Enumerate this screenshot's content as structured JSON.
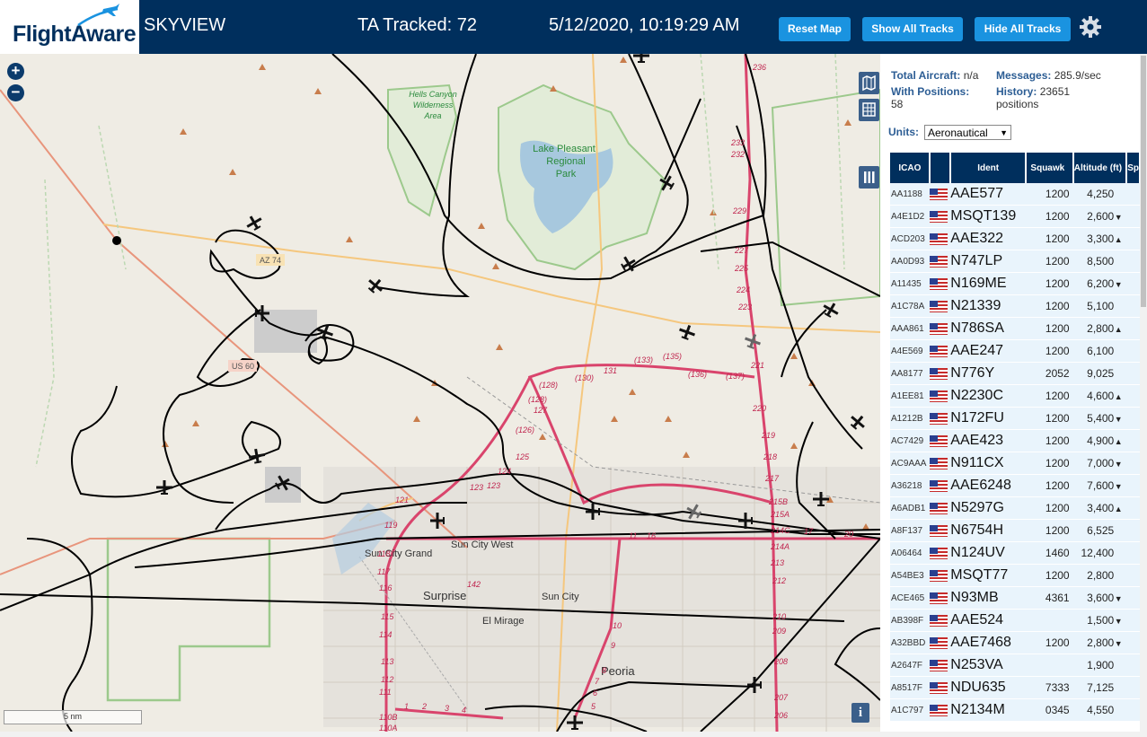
{
  "header": {
    "logo_text": "FlightAware",
    "app_name": "SKYVIEW",
    "tracked": "TA Tracked: 72",
    "datetime": "5/12/2020, 10:19:29 AM",
    "buttons": {
      "reset": "Reset Map",
      "show_all": "Show All Tracks",
      "hide_all": "Hide All Tracks"
    },
    "settings_icon": "gear-icon"
  },
  "map": {
    "zoom_in": "+",
    "zoom_out": "−",
    "scale": "5 nm",
    "info": "i",
    "tool_icons": [
      "map-layers-icon",
      "grid-icon",
      "columns-icon"
    ],
    "labels": {
      "wilderness": [
        "Hells Canyon",
        "Wilderness",
        "Area"
      ],
      "lake": [
        "Lake Pleasant",
        "Regional",
        "Park"
      ],
      "az74": "AZ 74",
      "us60": "US 60",
      "sun_city_west": "Sun City West",
      "sun_city_grand": "Sun City Grand",
      "surprise": "Surprise",
      "sun_city": "Sun City",
      "el_mirage": "El Mirage",
      "peoria": "Peoria"
    },
    "exits": [
      "236",
      "233",
      "232",
      "229",
      "227",
      "225",
      "224",
      "223",
      "221",
      "220",
      "219",
      "218",
      "217",
      "215B",
      "215A",
      "214C",
      "214A",
      "213",
      "212",
      "210",
      "209",
      "208",
      "207",
      "206",
      "(128)",
      "(130)",
      "131",
      "(133)",
      "(135)",
      "(136)",
      "(137)",
      "(128)",
      "127",
      "(126)",
      "125",
      "124",
      "123",
      "123",
      "121",
      "119",
      "118",
      "117",
      "116",
      "115",
      "114",
      "113",
      "112",
      "111",
      "110B",
      "110A",
      "142",
      "1",
      "2",
      "3",
      "4",
      "5",
      "6",
      "7",
      "8",
      "9",
      "10",
      "11",
      "16",
      "17",
      "20",
      "24",
      "26"
    ]
  },
  "sidebar": {
    "total_aircraft_label": "Total Aircraft:",
    "total_aircraft": "n/a",
    "messages_label": "Messages:",
    "messages": "285.9/sec",
    "with_positions_label": "With Positions:",
    "with_positions": "58",
    "history_label": "History:",
    "history": "23651",
    "history_unit": "positions",
    "units_label": "Units:",
    "units_value": "Aeronautical",
    "columns": [
      "ICAO",
      "",
      "Ident",
      "Squawk",
      "Altitude (ft)",
      "Sp"
    ],
    "rows": [
      {
        "icao": "AA1188",
        "ident": "AAE577",
        "squawk": "1200",
        "alt": "4,250",
        "trend": ""
      },
      {
        "icao": "A4E1D2",
        "ident": "MSQT139",
        "squawk": "1200",
        "alt": "2,600",
        "trend": "▼"
      },
      {
        "icao": "ACD203",
        "ident": "AAE322",
        "squawk": "1200",
        "alt": "3,300",
        "trend": "▲"
      },
      {
        "icao": "AA0D93",
        "ident": "N747LP",
        "squawk": "1200",
        "alt": "8,500",
        "trend": ""
      },
      {
        "icao": "A11435",
        "ident": "N169ME",
        "squawk": "1200",
        "alt": "6,200",
        "trend": "▼"
      },
      {
        "icao": "A1C78A",
        "ident": "N21339",
        "squawk": "1200",
        "alt": "5,100",
        "trend": ""
      },
      {
        "icao": "AAA861",
        "ident": "N786SA",
        "squawk": "1200",
        "alt": "2,800",
        "trend": "▲"
      },
      {
        "icao": "A4E569",
        "ident": "AAE247",
        "squawk": "1200",
        "alt": "6,100",
        "trend": ""
      },
      {
        "icao": "AA8177",
        "ident": "N776Y",
        "squawk": "2052",
        "alt": "9,025",
        "trend": ""
      },
      {
        "icao": "A1EE81",
        "ident": "N2230C",
        "squawk": "1200",
        "alt": "4,600",
        "trend": "▲"
      },
      {
        "icao": "A1212B",
        "ident": "N172FU",
        "squawk": "1200",
        "alt": "5,400",
        "trend": "▼"
      },
      {
        "icao": "AC7429",
        "ident": "AAE423",
        "squawk": "1200",
        "alt": "4,900",
        "trend": "▲"
      },
      {
        "icao": "AC9AAA",
        "ident": "N911CX",
        "squawk": "1200",
        "alt": "7,000",
        "trend": "▼"
      },
      {
        "icao": "A36218",
        "ident": "AAE6248",
        "squawk": "1200",
        "alt": "7,600",
        "trend": "▼"
      },
      {
        "icao": "A6ADB1",
        "ident": "N5297G",
        "squawk": "1200",
        "alt": "3,400",
        "trend": "▲"
      },
      {
        "icao": "A8F137",
        "ident": "N6754H",
        "squawk": "1200",
        "alt": "6,525",
        "trend": ""
      },
      {
        "icao": "A06464",
        "ident": "N124UV",
        "squawk": "1460",
        "alt": "12,400",
        "trend": ""
      },
      {
        "icao": "A54BE3",
        "ident": "MSQT77",
        "squawk": "1200",
        "alt": "2,800",
        "trend": ""
      },
      {
        "icao": "ACE465",
        "ident": "N93MB",
        "squawk": "4361",
        "alt": "3,600",
        "trend": "▼"
      },
      {
        "icao": "AB398F",
        "ident": "AAE524",
        "squawk": "",
        "alt": "1,500",
        "trend": "▼"
      },
      {
        "icao": "A32BBD",
        "ident": "AAE7468",
        "squawk": "1200",
        "alt": "2,800",
        "trend": "▼"
      },
      {
        "icao": "A2647F",
        "ident": "N253VA",
        "squawk": "",
        "alt": "1,900",
        "trend": ""
      },
      {
        "icao": "A8517F",
        "ident": "NDU635",
        "squawk": "7333",
        "alt": "7,125",
        "trend": ""
      },
      {
        "icao": "A1C797",
        "ident": "N2134M",
        "squawk": "0345",
        "alt": "4,550",
        "trend": ""
      }
    ]
  },
  "colors": {
    "header_bg": "#002f5d",
    "button_bg": "#1a93e0",
    "table_header_bg": "#002f5d",
    "row_bg": "#e9f4fc",
    "map_bg": "#efece4",
    "highway": "#d9446c"
  }
}
